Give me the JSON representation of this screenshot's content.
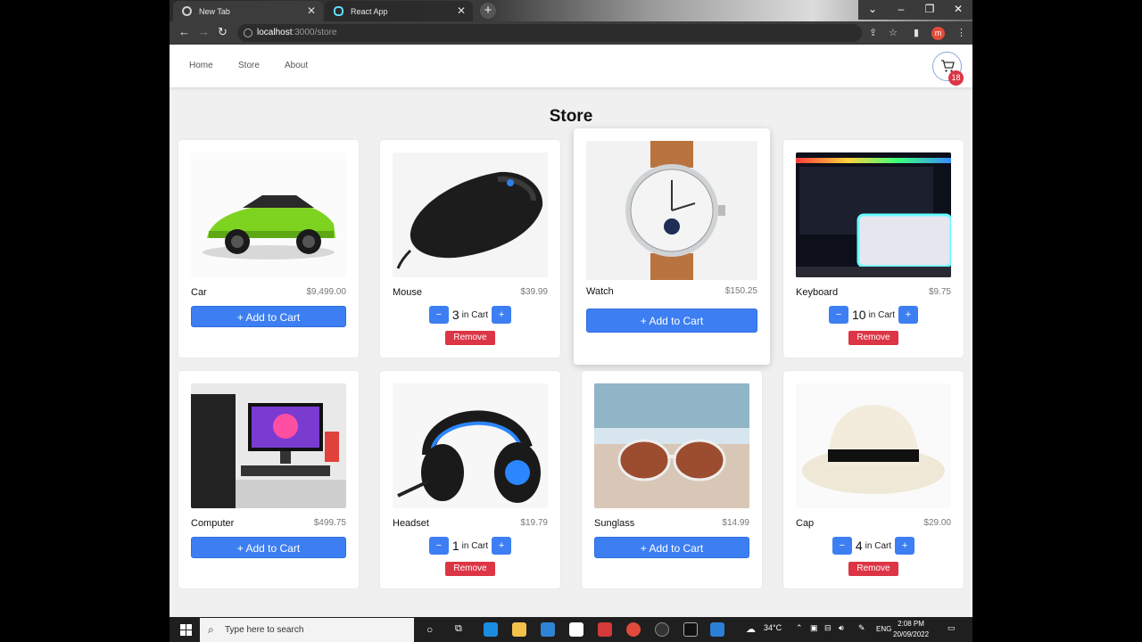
{
  "browser": {
    "tabs": [
      {
        "title": "New Tab",
        "active": true
      },
      {
        "title": "React App",
        "active": false
      }
    ],
    "address": {
      "host": "localhost",
      "path": ":3000/store"
    }
  },
  "navbar": {
    "links": [
      "Home",
      "Store",
      "About"
    ],
    "cart_count": "18"
  },
  "page": {
    "title": "Store"
  },
  "labels": {
    "add": "+ Add to Cart",
    "in_cart": "in Cart",
    "remove": "Remove",
    "minus": "−",
    "plus": "+"
  },
  "products": [
    {
      "name": "Car",
      "price": "$9,499.00",
      "qty": 0,
      "image": "car"
    },
    {
      "name": "Mouse",
      "price": "$39.99",
      "qty": 3,
      "image": "mouse"
    },
    {
      "name": "Watch",
      "price": "$150.25",
      "qty": 0,
      "image": "watch"
    },
    {
      "name": "Keyboard",
      "price": "$9.75",
      "qty": 10,
      "image": "keyboard"
    },
    {
      "name": "Computer",
      "price": "$499.75",
      "qty": 0,
      "image": "computer"
    },
    {
      "name": "Headset",
      "price": "$19.79",
      "qty": 1,
      "image": "headset"
    },
    {
      "name": "Sunglass",
      "price": "$14.99",
      "qty": 0,
      "image": "sunglasses"
    },
    {
      "name": "Cap",
      "price": "$29.00",
      "qty": 4,
      "image": "hat"
    }
  ],
  "taskbar": {
    "search_placeholder": "Type here to search",
    "weather": "34°C",
    "language": "ENG",
    "time": "2:08 PM",
    "date": "20/09/2022"
  },
  "colors": {
    "primary": "#3d7ff2",
    "danger": "#dc3545"
  }
}
